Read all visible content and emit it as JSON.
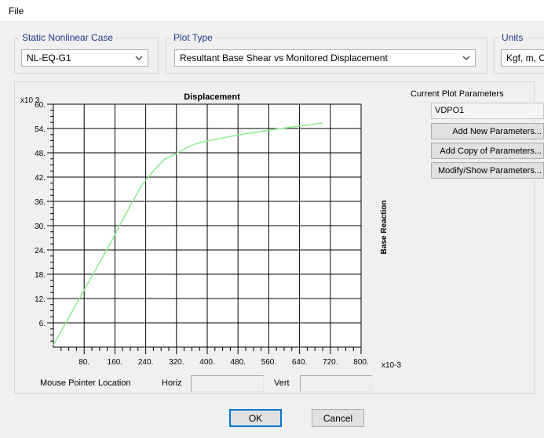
{
  "menu": {
    "file": "File"
  },
  "case_group": {
    "legend": "Static Nonlinear Case",
    "value": "NL-EQ-G1"
  },
  "plot_type_group": {
    "legend": "Plot Type",
    "value": "Resultant Base Shear vs Monitored Displacement"
  },
  "units_group": {
    "legend": "Units",
    "value": "Kgf, m, C"
  },
  "plot_params": {
    "label": "Current Plot Parameters",
    "current": "VDPO1",
    "buttons": [
      "Add New Parameters...",
      "Add Copy of Parameters...",
      "Modify/Show Parameters..."
    ]
  },
  "mouse_pointer": {
    "label": "Mouse Pointer Location",
    "horiz_label": "Horiz",
    "vert_label": "Vert",
    "horiz_value": "",
    "vert_value": ""
  },
  "dialog_buttons": {
    "ok": "OK",
    "cancel": "Cancel"
  },
  "colors": {
    "curve": "#90ee90",
    "legend_text": "#1e3c8c"
  },
  "chart_data": {
    "type": "line",
    "title": "Displacement",
    "ylabel": "Base Reaction",
    "x_multiplier": "x10-3",
    "y_multiplier": "x10 3",
    "xlim": [
      0,
      800
    ],
    "ylim": [
      0,
      60
    ],
    "x_ticks": [
      "80.",
      "160.",
      "240.",
      "320.",
      "400.",
      "480.",
      "560.",
      "640.",
      "720.",
      "800."
    ],
    "x_tick_values": [
      80,
      160,
      240,
      320,
      400,
      480,
      560,
      640,
      720,
      800
    ],
    "y_ticks": [
      "6.",
      "12.",
      "18.",
      "24.",
      "30.",
      "36.",
      "42.",
      "48.",
      "54.",
      "60."
    ],
    "y_tick_values": [
      6,
      12,
      18,
      24,
      30,
      36,
      42,
      48,
      54,
      60
    ],
    "grid": true,
    "series": [
      {
        "x": [
          0,
          50,
          100,
          150,
          200,
          230,
          260,
          290,
          320,
          350,
          380,
          420,
          480,
          560,
          640,
          700
        ],
        "y": [
          0.5,
          9,
          17.5,
          26,
          35,
          40,
          43.5,
          46.5,
          47.8,
          49.5,
          50.5,
          51.3,
          52.4,
          53.6,
          54.6,
          55.4
        ]
      }
    ]
  }
}
